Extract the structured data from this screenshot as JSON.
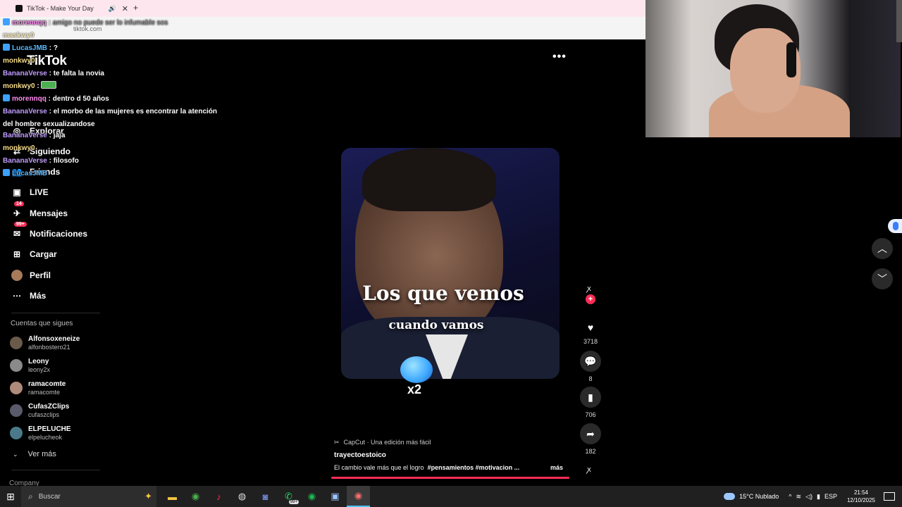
{
  "browser": {
    "tab_title": "TikTok - Make Your Day",
    "tab_close": "✕",
    "tab_audio": "🔊",
    "new_tab": "+",
    "url": "tiktok.com"
  },
  "chat": [
    {
      "user": "LucasJMB",
      "color": "blue",
      "msg": "?",
      "badge": true
    },
    {
      "user": "monkwy0",
      "color": "gold",
      "msg": "",
      "badge": false
    },
    {
      "user": "BananaVerse",
      "color": "purple",
      "msg": "te falta la novia",
      "badge": false
    },
    {
      "user": "monkwy0",
      "color": "gold",
      "msg": "",
      "badge": false,
      "emote": true
    },
    {
      "user": "morennqq",
      "color": "pink",
      "msg": "dentro d 50 años",
      "badge": true
    },
    {
      "user": "BananaVerse",
      "color": "purple",
      "msg": "el morbo de las mujeres es encontrar la atención del hombre sexualizandose",
      "badge": false
    },
    {
      "user": "BananaVerse",
      "color": "purple",
      "msg": "jaja",
      "badge": false
    },
    {
      "user": "monkwy0",
      "color": "gold",
      "msg": "",
      "badge": false
    },
    {
      "user": "BananaVerse",
      "color": "purple",
      "msg": "filosofo",
      "badge": false
    },
    {
      "user": "LucasJMB",
      "color": "blue",
      "msg": "",
      "badge": true
    }
  ],
  "chat_top": {
    "line1_user": "morennqq",
    "line1_msg": "amigo no puede ser lo infumable",
    "line1_tail": "sos",
    "line2_user": "maskwy0"
  },
  "sidebar": {
    "logo": "TikTok",
    "items": [
      {
        "label": "Explorar",
        "icon": "compass-icon",
        "glyph": "◎"
      },
      {
        "label": "Siguiendo",
        "icon": "following-icon",
        "glyph": "⇄"
      },
      {
        "label": "Friends",
        "icon": "friends-icon",
        "glyph": "👥"
      },
      {
        "label": "LIVE",
        "icon": "live-icon",
        "glyph": "▣"
      },
      {
        "label": "Mensajes",
        "icon": "messages-icon",
        "glyph": "✈",
        "badge": "14"
      },
      {
        "label": "Notificaciones",
        "icon": "notifications-icon",
        "glyph": "✉",
        "badge": "99+"
      },
      {
        "label": "Cargar",
        "icon": "upload-icon",
        "glyph": "⊞"
      },
      {
        "label": "Perfil",
        "icon": "profile-avatar",
        "glyph": ""
      },
      {
        "label": "Más",
        "icon": "more-icon",
        "glyph": "⋯"
      }
    ],
    "following_title": "Cuentas que sigues",
    "following": [
      {
        "name": "Alfonsoxeneize",
        "handle": "alfonbostero21"
      },
      {
        "name": "Leony",
        "handle": "leony2x"
      },
      {
        "name": "ramacomte",
        "handle": "ramacomte"
      },
      {
        "name": "CufasZClips",
        "handle": "cufaszclips"
      },
      {
        "name": "ELPELUCHE",
        "handle": "elpelucheok"
      }
    ],
    "ver_mas": "Ver más",
    "company": "Company"
  },
  "video": {
    "title": "Los que vemos",
    "subtitle": "cuando vamos",
    "emote_multiplier": "x2",
    "more_options": "•••"
  },
  "actions": {
    "likes": "3718",
    "comments": "8",
    "saves": "706",
    "shares": "182"
  },
  "caption": {
    "capcut": "CapCut · Una edición más fácil",
    "author": "trayectoestoico",
    "text": "El cambio vale más que el logro",
    "tags": "#pensamientos #motivacion ...",
    "more": "más"
  },
  "taskbar": {
    "search_placeholder": "Buscar",
    "whatsapp_badge": "99+",
    "weather": "15°C  Nublado",
    "lang": "ESP",
    "time": "21:54",
    "date": "12/10/2025"
  },
  "colors": {
    "accent": "#fe2c55",
    "taskbar": "#202020"
  }
}
